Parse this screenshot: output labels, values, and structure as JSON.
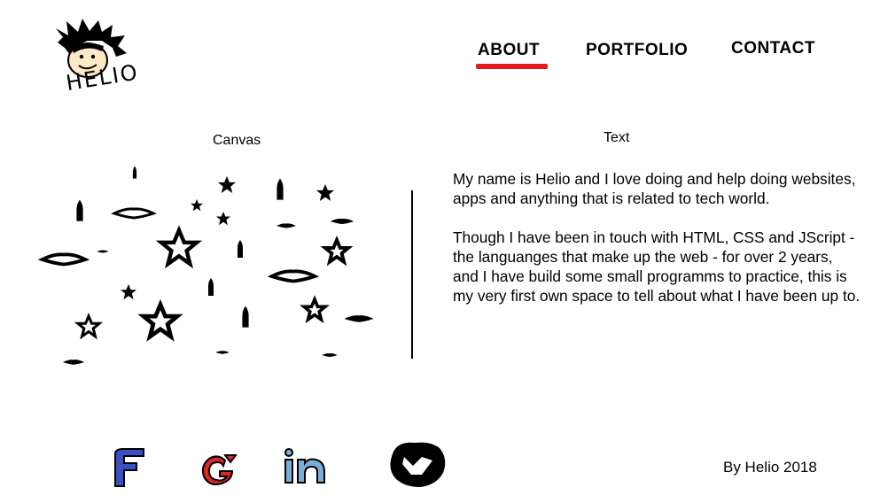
{
  "logo": {
    "text": "HELIO"
  },
  "nav": {
    "items": [
      {
        "label": "ABOUT",
        "active": true
      },
      {
        "label": "PORTFOLIO",
        "active": false
      },
      {
        "label": "CONTACT",
        "active": false
      }
    ],
    "active_color": "#e8191e"
  },
  "canvas_section": {
    "title": "Canvas"
  },
  "text_section": {
    "title": "Text",
    "paragraphs": [
      "My name is Helio and I love doing and help doing websites, apps and anything that is related to tech world.",
      "Though I have been in touch with HTML, CSS and JScript - the languanges that make up the web - for over 2 years, and I have build some small programms to practice, this is my very first own space to tell about what I have been up to."
    ]
  },
  "social": [
    {
      "icon": "facebook-icon",
      "color": "#3b4fc4"
    },
    {
      "icon": "google-plus-icon",
      "color": "#e02525"
    },
    {
      "icon": "linkedin-icon",
      "color": "#7aaed6"
    },
    {
      "icon": "github-icon",
      "color": "#000000"
    }
  ],
  "footer": {
    "text": "By Helio 2018"
  }
}
